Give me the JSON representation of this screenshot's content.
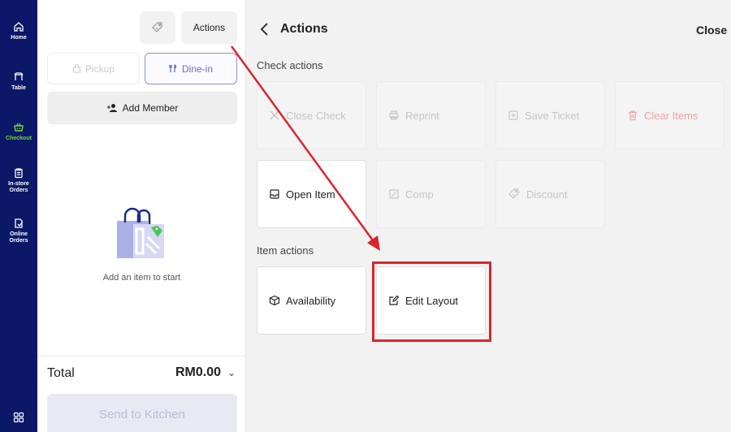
{
  "nav": {
    "items": [
      {
        "label": "Home",
        "icon": "home-icon"
      },
      {
        "label": "Table",
        "icon": "table-icon"
      },
      {
        "label": "Checkout",
        "icon": "basket-icon"
      },
      {
        "label": "In-store Orders",
        "icon": "clipboard-icon"
      },
      {
        "label": "Online Orders",
        "icon": "online-order-icon"
      }
    ],
    "active": "Checkout",
    "active_color": "#7fd13b",
    "bg_color": "#0b1868"
  },
  "order": {
    "actions_label": "Actions",
    "pickup_label": "Pickup",
    "dinein_label": "Dine-in",
    "add_member_label": "Add Member",
    "empty_text": "Add an item to start",
    "total_label": "Total",
    "total_value": "RM0.00",
    "send_label": "Send to Kitchen"
  },
  "actions_panel": {
    "title": "Actions",
    "close_label": "Close",
    "check_section": "Check actions",
    "item_section": "Item actions",
    "check_actions": [
      {
        "label": "Close Check",
        "icon": "close-icon",
        "state": "disabled"
      },
      {
        "label": "Reprint",
        "icon": "printer-icon",
        "state": "disabled"
      },
      {
        "label": "Save Ticket",
        "icon": "save-icon",
        "state": "disabled"
      },
      {
        "label": "Clear Items",
        "icon": "trash-icon",
        "state": "disabled-danger"
      },
      {
        "label": "Open Item",
        "icon": "open-item-icon",
        "state": "enabled"
      },
      {
        "label": "Comp",
        "icon": "comp-icon",
        "state": "disabled"
      },
      {
        "label": "Discount",
        "icon": "discount-icon",
        "state": "disabled"
      }
    ],
    "item_actions": [
      {
        "label": "Availability",
        "icon": "box-icon",
        "state": "enabled"
      },
      {
        "label": "Edit Layout",
        "icon": "edit-icon",
        "state": "enabled"
      }
    ]
  },
  "annotation": {
    "color": "#d9262c"
  }
}
